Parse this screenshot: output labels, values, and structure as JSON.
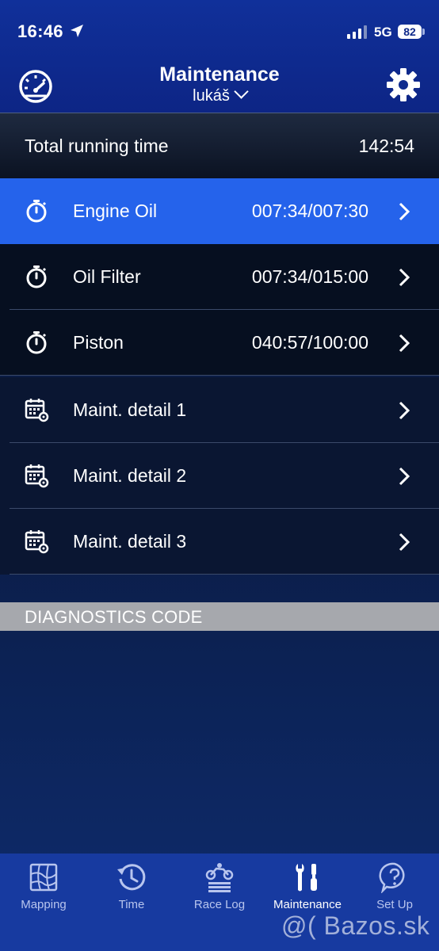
{
  "status_bar": {
    "time": "16:46",
    "network": "5G",
    "battery": "82"
  },
  "header": {
    "title": "Maintenance",
    "user": "lukáš"
  },
  "total": {
    "label": "Total running time",
    "value": "142:54"
  },
  "items": [
    {
      "label": "Engine Oil",
      "value": "007:34/007:30",
      "icon": "stopwatch-icon",
      "state": "highlighted"
    },
    {
      "label": "Oil Filter",
      "value": "007:34/015:00",
      "icon": "stopwatch-icon"
    },
    {
      "label": "Piston",
      "value": "040:57/100:00",
      "icon": "stopwatch-icon"
    },
    {
      "label": "Maint. detail 1",
      "value": "",
      "icon": "calendar-gear-icon"
    },
    {
      "label": "Maint. detail 2",
      "value": "",
      "icon": "calendar-gear-icon"
    },
    {
      "label": "Maint. detail 3",
      "value": "",
      "icon": "calendar-gear-icon"
    }
  ],
  "diagnostics": {
    "label": "DIAGNOSTICS CODE"
  },
  "tabs": [
    {
      "label": "Mapping",
      "icon": "map-icon"
    },
    {
      "label": "Time",
      "icon": "clock-icon"
    },
    {
      "label": "Race Log",
      "icon": "motorbike-icon"
    },
    {
      "label": "Maintenance",
      "icon": "tools-icon",
      "selected": true
    },
    {
      "label": "Set Up",
      "icon": "help-icon"
    }
  ],
  "watermark": "@( Bazos.sk",
  "colors": {
    "header": "#10309a",
    "highlight": "#2563eb",
    "tabbar": "#173aa0",
    "diagnostics_bar": "#a6a8ad"
  }
}
